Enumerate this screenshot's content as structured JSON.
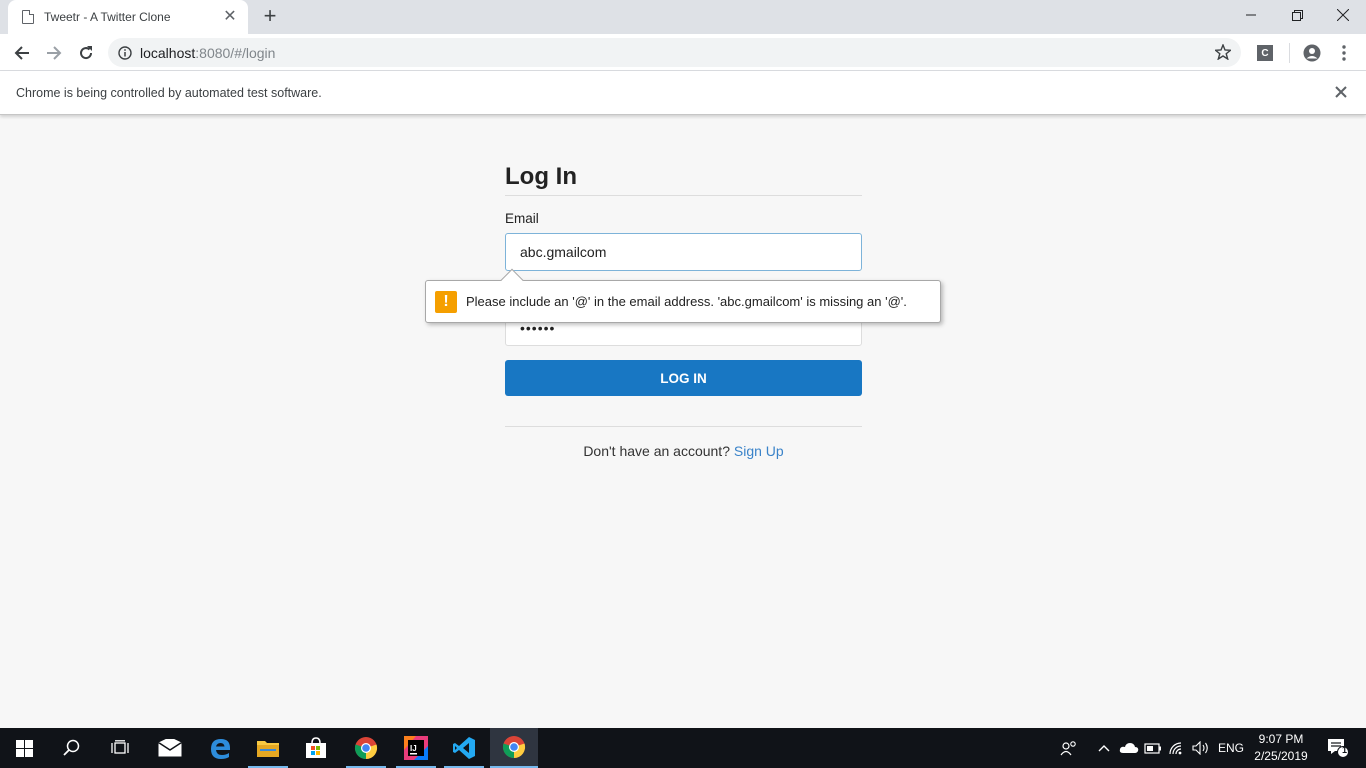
{
  "browser": {
    "tab": {
      "title": "Tweetr - A Twitter Clone"
    },
    "url": {
      "host": "localhost",
      "port_path": ":8080/#/login"
    },
    "infobar": {
      "message": "Chrome is being controlled by automated test software."
    },
    "profile_initial": "C"
  },
  "page": {
    "heading": "Log In",
    "email_label": "Email",
    "email_value": "abc.gmailcom",
    "password_mask": "••••••",
    "login_button": "LOG IN",
    "signup_prompt": "Don't have an account?",
    "signup_link": "Sign Up"
  },
  "validation": {
    "icon": "!",
    "message": "Please include an '@' in the email address. 'abc.gmailcom' is missing an '@'."
  },
  "taskbar": {
    "language": "ENG",
    "time": "9:07 PM",
    "date": "2/25/2019",
    "notification_count": "1"
  },
  "colors": {
    "accent_button": "#1877c3",
    "link": "#3a83c9",
    "warning": "#f59f00",
    "page_bg": "#f7f7f7"
  }
}
